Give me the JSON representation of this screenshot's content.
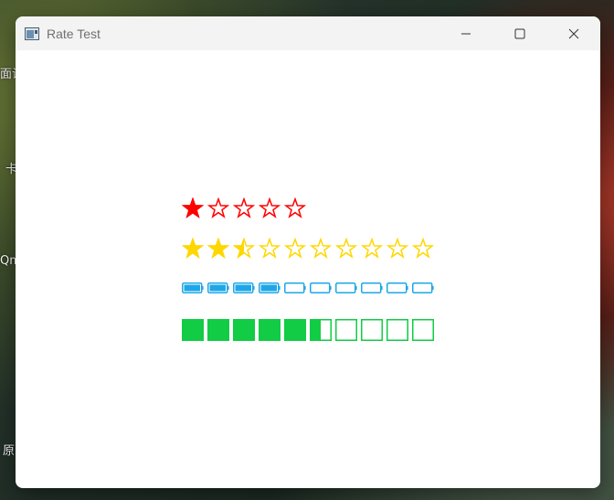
{
  "window": {
    "title": "Rate Test",
    "app_icon": "app-window-icon",
    "controls": [
      "minimize-icon",
      "maximize-icon",
      "close-icon"
    ]
  },
  "desktop_labels": [
    "面试",
    "卡",
    "Qm",
    "原"
  ],
  "ratings": [
    {
      "name": "red-star-rate",
      "icon": "star-icon",
      "max": 5,
      "value": 1,
      "color": "#ff0000"
    },
    {
      "name": "yellow-star-rate",
      "icon": "star-icon",
      "max": 10,
      "value": 2.5,
      "color": "#ffd700"
    },
    {
      "name": "battery-rate",
      "icon": "battery-icon",
      "max": 10,
      "value": 4,
      "color": "#1ea7e8"
    },
    {
      "name": "block-rate",
      "icon": "square-icon",
      "max": 10,
      "value": 5.5,
      "color": "#11cc44"
    }
  ]
}
